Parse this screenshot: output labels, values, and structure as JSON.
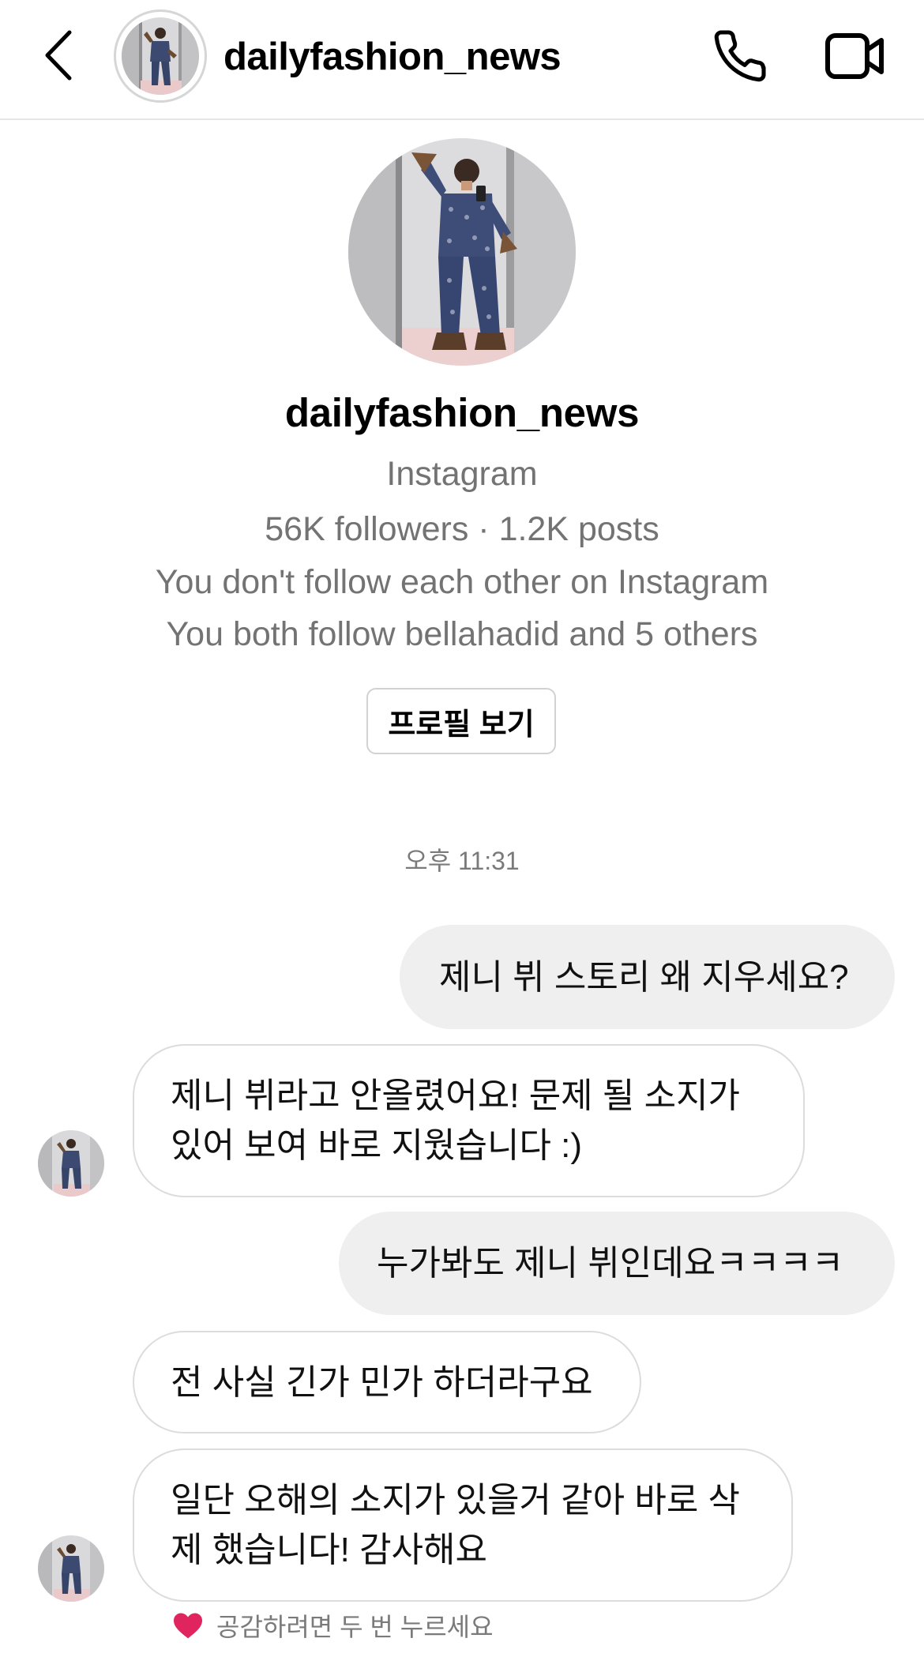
{
  "header": {
    "username": "dailyfashion_news"
  },
  "profile": {
    "name": "dailyfashion_news",
    "platform": "Instagram",
    "stats": "56K followers · 1.2K posts",
    "follow_status": "You don't follow each other on Instagram",
    "mutuals": "You both follow bellahadid and 5 others",
    "view_profile_label": "프로필 보기"
  },
  "conversation": {
    "timestamp": "오후 11:31",
    "messages": [
      {
        "sender": "me",
        "text": "제니 뷔 스토리 왜 지우세요?"
      },
      {
        "sender": "them",
        "text": "제니 뷔라고 안올렸어요! 문제 될 소지가\n있어 보여 바로 지웠습니다 :)"
      },
      {
        "sender": "me",
        "text": "누가봐도 제니 뷔인데요ㅋㅋㅋㅋ"
      },
      {
        "sender": "them",
        "text": "전 사실 긴가 민가 하더라구요"
      },
      {
        "sender": "them",
        "text": "일단 오해의 소지가 있을거 같아 바로 삭\n제 했습니다! 감사해요"
      }
    ],
    "reaction_hint": "공감하려면 두 번 누르세요"
  },
  "colors": {
    "outgoing_bubble": "#efefef",
    "incoming_border": "#dcdcdc",
    "secondary_text": "#737373",
    "heart": "#e0245e"
  },
  "icons": [
    "chevron-left-icon",
    "phone-icon",
    "video-camera-icon",
    "heart-icon"
  ]
}
